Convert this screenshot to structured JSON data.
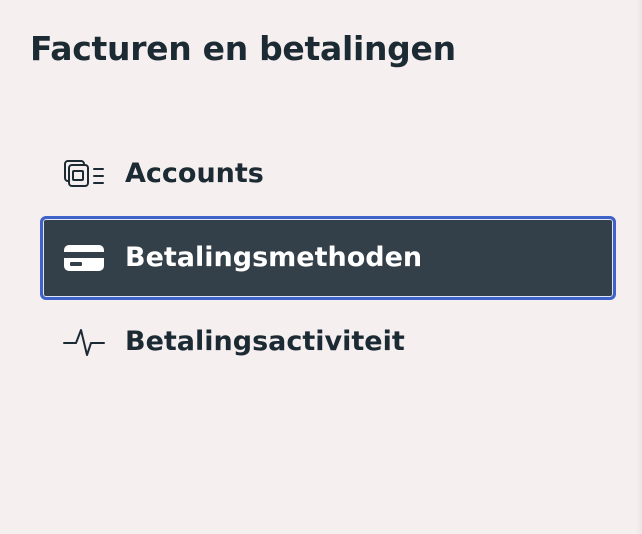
{
  "panel": {
    "title": "Facturen en betalingen"
  },
  "nav": {
    "items": [
      {
        "label": "Accounts",
        "icon": "accounts-stack-icon",
        "active": false
      },
      {
        "label": "Betalingsmethoden",
        "icon": "credit-card-icon",
        "active": true
      },
      {
        "label": "Betalingsactiviteit",
        "icon": "activity-pulse-icon",
        "active": false
      }
    ]
  },
  "colors": {
    "background": "#f5eff0",
    "text": "#1c2b33",
    "active_background": "#344049",
    "active_border": "#3f62c9",
    "active_text": "#ffffff"
  }
}
